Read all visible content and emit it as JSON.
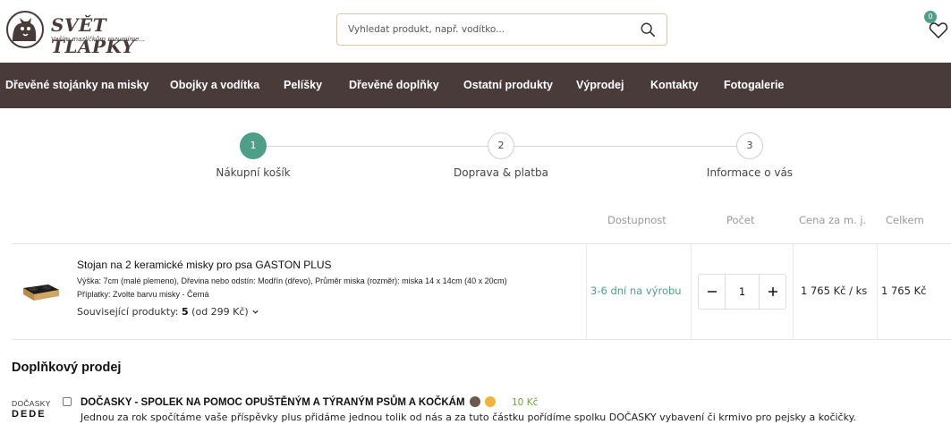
{
  "header": {
    "logo_text": "SVĚT TLAPKY",
    "logo_tagline": "Vaším mazlíčkům rozumíme...",
    "search_placeholder": "Vyhledat produkt, např. vodítko...",
    "wishlist_count": "0"
  },
  "nav": {
    "items": [
      "Dřevěné stojánky na misky",
      "Obojky a vodítka",
      "Pelíšky",
      "Dřevěné doplňky",
      "Ostatní produkty",
      "Výprodej",
      "Kontakty",
      "Fotogalerie"
    ]
  },
  "steps": [
    {
      "num": "1",
      "label": "Nákupní košík",
      "active": true
    },
    {
      "num": "2",
      "label": "Doprava & platba",
      "active": false
    },
    {
      "num": "3",
      "label": "Informace o vás",
      "active": false
    }
  ],
  "cart_table": {
    "headers": {
      "availability": "Dostupnost",
      "quantity": "Počet",
      "unit_price": "Cena za m. j.",
      "total": "Celkem"
    },
    "item": {
      "name": "Stojan na 2 keramické misky pro psa GASTON PLUS",
      "attributes": "Výška: 7cm (malé plemeno), Dřevina nebo odstín: Modřín (dřevo), Průměr miska (rozměr): miska 14 x 14cm (40 x 20cm)",
      "extras": "Příplatky: Zvolte barvu misky - Černá",
      "related_label": "Související produkty:",
      "related_count": "5",
      "related_from": "(od 299 Kč)",
      "availability": "3-6 dní na výrobu",
      "quantity": "1",
      "unit_price": "1 765 Kč / ks",
      "total": "1 765 Kč"
    }
  },
  "upsell": {
    "title": "Doplňkový prodej",
    "logo_top": "DOČASKY",
    "logo_bottom": "DEDE",
    "name": "DOČASKY - SPOLEK NA POMOC OPUŠTĚNÝM A TÝRANÝM PSŮM A KOČKÁM",
    "price": "10 Kč",
    "description": "Jednou za rok spočítáme vaše příspěvky plus přidáme jednou tolik od nás a za tuto částku pořídíme spolku DOČASKY vybavení či krmivo pro pejsky a kočičky."
  },
  "colors": {
    "brand_dark": "#4a3b3b",
    "accent_green": "#4f9e88",
    "price_green": "#6aa63c"
  }
}
